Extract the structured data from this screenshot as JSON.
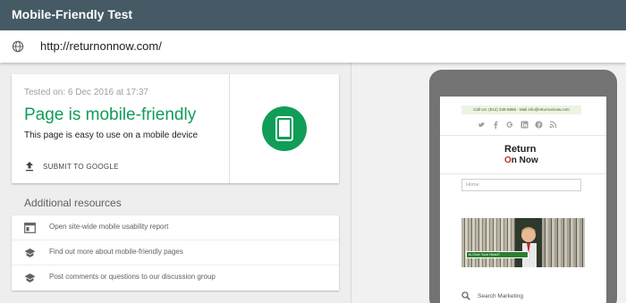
{
  "app": {
    "title": "Mobile-Friendly Test"
  },
  "url_bar": {
    "url": "http://returnonnow.com/",
    "icon": "globe-icon"
  },
  "result": {
    "tested_on": "Tested on: 6 Dec 2016 at 17:37",
    "headline": "Page is mobile-friendly",
    "description": "This page is easy to use on a mobile device",
    "submit_label": "SUBMIT TO GOOGLE",
    "status_color": "#0f9d58",
    "badge_icon": "smartphone-icon"
  },
  "resources": {
    "heading": "Additional resources",
    "items": [
      {
        "label": "Open site-wide mobile usability report",
        "icon": "report-icon"
      },
      {
        "label": "Find out more about mobile-friendly pages",
        "icon": "school-icon"
      },
      {
        "label": "Post comments or questions to our discussion group",
        "icon": "school-icon"
      }
    ]
  },
  "preview": {
    "top_bar": "Call Us: (512) 348-6868 - Mail info@returnonnow.com",
    "logo_line1": "Return",
    "logo_line2_prefix": "n Now",
    "logo_mark": "O",
    "home_field": "Home",
    "banner_tag": "Is Over Your Head?",
    "search_label": "Search Marketing",
    "social_icons": [
      "twitter-icon",
      "facebook-icon",
      "google-plus-icon",
      "linkedin-icon",
      "pinterest-icon",
      "rss-icon"
    ]
  },
  "colors": {
    "appbar": "#455a64",
    "accent": "#0f9d58",
    "phone_frame": "#737373"
  }
}
